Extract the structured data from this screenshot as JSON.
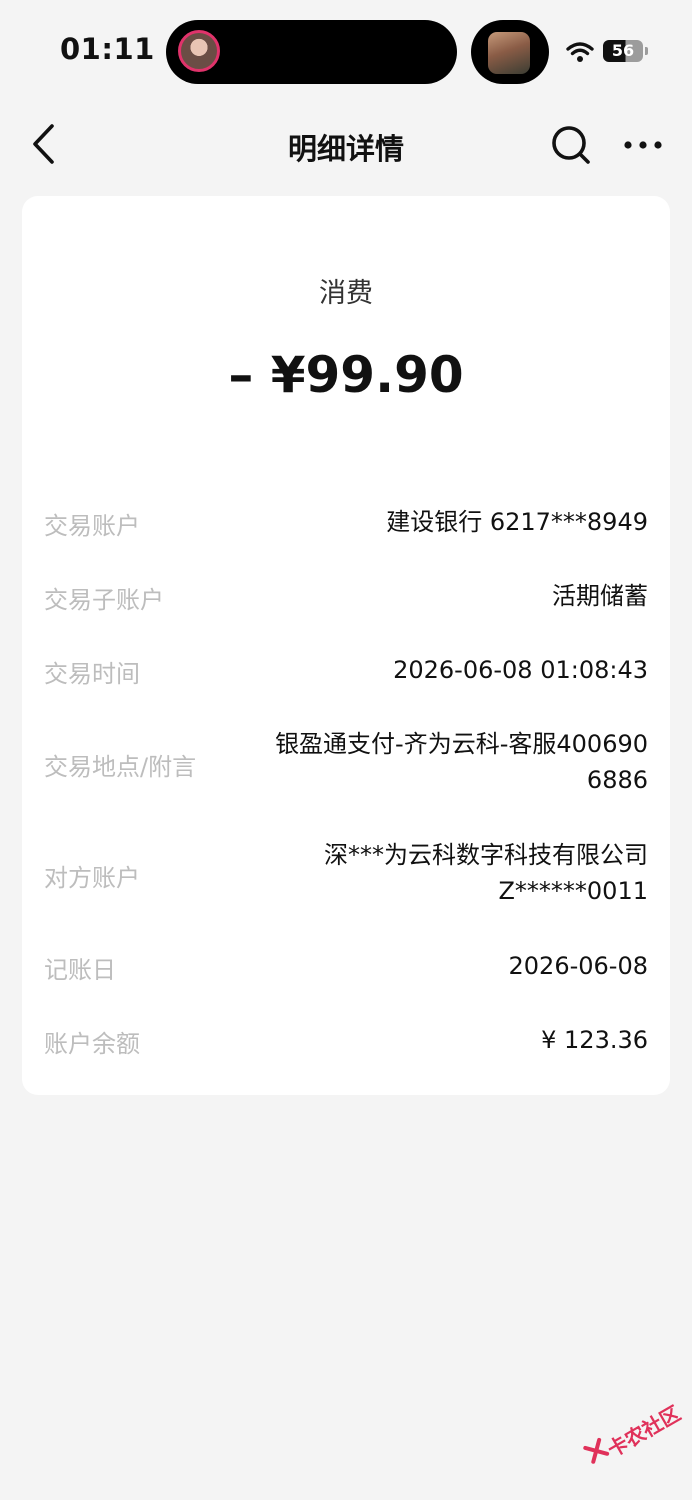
{
  "status_bar": {
    "time": "01:11",
    "battery": "56"
  },
  "nav": {
    "title": "明细详情"
  },
  "transaction": {
    "type": "消费",
    "amount": "– ¥99.90"
  },
  "details": [
    {
      "label": "交易账户",
      "value": "建设银行 6217***8949"
    },
    {
      "label": "交易子账户",
      "value": "活期储蓄"
    },
    {
      "label": "交易时间",
      "value": "2026-06-08 01:08:43"
    },
    {
      "label": "交易地点/附言",
      "value_lines": [
        "银盈通支付-齐为云科-客服400690",
        "6886"
      ]
    },
    {
      "label": "对方账户",
      "value_lines": [
        "深***为云科数字科技有限公司",
        "Z******0011"
      ]
    },
    {
      "label": "记账日",
      "value": "2026-06-08"
    },
    {
      "label": "账户余额",
      "value": "¥ 123.36"
    }
  ],
  "watermark": {
    "text": "卡农社区"
  },
  "colors": {
    "background": "#f4f4f4",
    "card": "#ffffff",
    "label": "#bdbdbd",
    "watermark": "#e0315a"
  }
}
